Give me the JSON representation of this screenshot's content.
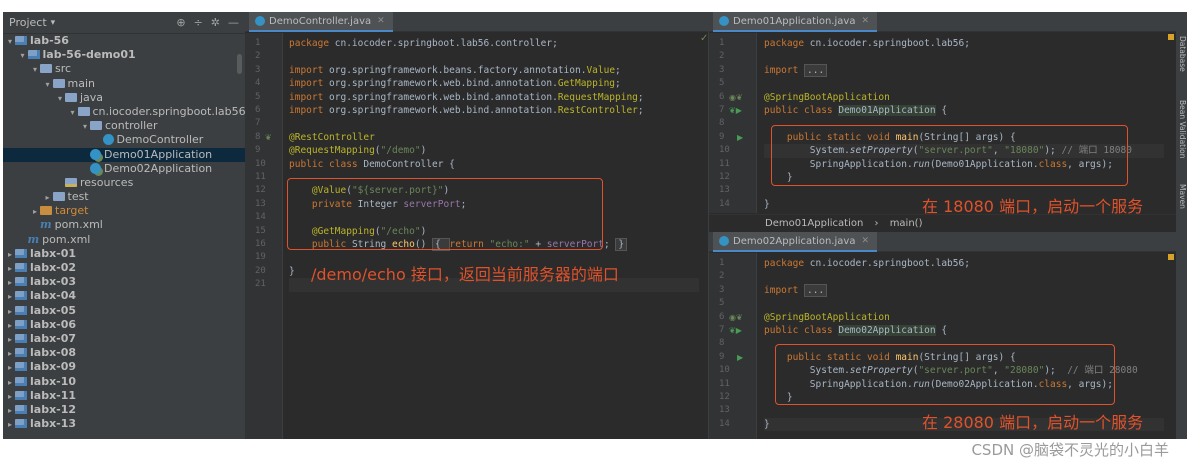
{
  "project_panel": {
    "title": "Project",
    "title_arrow": "▾",
    "header_icons": [
      "⊕",
      "÷",
      "✲",
      "—"
    ],
    "header_icon_names": [
      "locate-icon",
      "collapse-icon",
      "settings-icon",
      "hide-icon"
    ],
    "tree": [
      {
        "label": "lab-56",
        "indent": 0,
        "arrow": "▾",
        "icon": "module",
        "bold": true
      },
      {
        "label": "lab-56-demo01",
        "indent": 1,
        "arrow": "▾",
        "icon": "module",
        "bold": true
      },
      {
        "label": "src",
        "indent": 2,
        "arrow": "▾",
        "icon": "folder"
      },
      {
        "label": "main",
        "indent": 3,
        "arrow": "▾",
        "icon": "folder"
      },
      {
        "label": "java",
        "indent": 4,
        "arrow": "▾",
        "icon": "folder"
      },
      {
        "label": "cn.iocoder.springboot.lab56",
        "indent": 5,
        "arrow": "▾",
        "icon": "package"
      },
      {
        "label": "controller",
        "indent": 6,
        "arrow": "▾",
        "icon": "package"
      },
      {
        "label": "DemoController",
        "indent": 7,
        "arrow": "",
        "icon": "class"
      },
      {
        "label": "Demo01Application",
        "indent": 6,
        "arrow": "",
        "icon": "spring-class",
        "selected": true
      },
      {
        "label": "Demo02Application",
        "indent": 6,
        "arrow": "",
        "icon": "spring-class"
      },
      {
        "label": "resources",
        "indent": 4,
        "arrow": "",
        "icon": "resources"
      },
      {
        "label": "test",
        "indent": 3,
        "arrow": "▸",
        "icon": "folder"
      },
      {
        "label": "target",
        "indent": 2,
        "arrow": "▸",
        "icon": "target",
        "excluded": true
      },
      {
        "label": "pom.xml",
        "indent": 2,
        "arrow": "",
        "icon": "maven"
      },
      {
        "label": "pom.xml",
        "indent": 1,
        "arrow": "",
        "icon": "maven"
      },
      {
        "label": "labx-01",
        "indent": 0,
        "arrow": "▸",
        "icon": "module",
        "bold": true
      },
      {
        "label": "labx-02",
        "indent": 0,
        "arrow": "▸",
        "icon": "module",
        "bold": true
      },
      {
        "label": "labx-03",
        "indent": 0,
        "arrow": "▸",
        "icon": "module",
        "bold": true
      },
      {
        "label": "labx-04",
        "indent": 0,
        "arrow": "▸",
        "icon": "module",
        "bold": true
      },
      {
        "label": "labx-05",
        "indent": 0,
        "arrow": "▸",
        "icon": "module",
        "bold": true
      },
      {
        "label": "labx-06",
        "indent": 0,
        "arrow": "▸",
        "icon": "module",
        "bold": true
      },
      {
        "label": "labx-07",
        "indent": 0,
        "arrow": "▸",
        "icon": "module",
        "bold": true
      },
      {
        "label": "labx-08",
        "indent": 0,
        "arrow": "▸",
        "icon": "module",
        "bold": true
      },
      {
        "label": "labx-09",
        "indent": 0,
        "arrow": "▸",
        "icon": "module",
        "bold": true
      },
      {
        "label": "labx-10",
        "indent": 0,
        "arrow": "▸",
        "icon": "module",
        "bold": true
      },
      {
        "label": "labx-11",
        "indent": 0,
        "arrow": "▸",
        "icon": "module",
        "bold": true
      },
      {
        "label": "labx-12",
        "indent": 0,
        "arrow": "▸",
        "icon": "module",
        "bold": true
      },
      {
        "label": "labx-13",
        "indent": 0,
        "arrow": "▸",
        "icon": "module",
        "bold": true
      }
    ]
  },
  "editor_controller": {
    "tab": {
      "label": "DemoController.java",
      "close": "✕"
    },
    "line_numbers": [
      "1",
      "2",
      "3",
      "4",
      "5",
      "6",
      "7",
      "8",
      "9",
      "10",
      "11",
      "12",
      "13",
      "14",
      "15",
      "16",
      "19",
      "20",
      "21"
    ],
    "lines": [
      [
        {
          "t": "package ",
          "c": "kw"
        },
        {
          "t": "cn.iocoder.springboot.lab56.controller;"
        }
      ],
      [],
      [
        {
          "t": "import ",
          "c": "kw"
        },
        {
          "t": "org.springframework.beans.factory.annotation."
        },
        {
          "t": "Value",
          "c": "ann"
        },
        {
          "t": ";"
        }
      ],
      [
        {
          "t": "import ",
          "c": "kw"
        },
        {
          "t": "org.springframework.web.bind.annotation."
        },
        {
          "t": "GetMapping",
          "c": "ann"
        },
        {
          "t": ";"
        }
      ],
      [
        {
          "t": "import ",
          "c": "kw"
        },
        {
          "t": "org.springframework.web.bind.annotation."
        },
        {
          "t": "RequestMapping",
          "c": "ann"
        },
        {
          "t": ";"
        }
      ],
      [
        {
          "t": "import ",
          "c": "kw"
        },
        {
          "t": "org.springframework.web.bind.annotation."
        },
        {
          "t": "RestController",
          "c": "ann"
        },
        {
          "t": ";"
        }
      ],
      [],
      [
        {
          "t": "@RestController",
          "c": "ann"
        }
      ],
      [
        {
          "t": "@RequestMapping",
          "c": "ann"
        },
        {
          "t": "("
        },
        {
          "t": "\"/demo\"",
          "c": "str"
        },
        {
          "t": ")"
        }
      ],
      [
        {
          "t": "public class ",
          "c": "kw"
        },
        {
          "t": "DemoController {"
        }
      ],
      [],
      [
        {
          "t": "    "
        },
        {
          "t": "@Value",
          "c": "ann"
        },
        {
          "t": "("
        },
        {
          "t": "\"${server.port}\"",
          "c": "str"
        },
        {
          "t": ")"
        }
      ],
      [
        {
          "t": "    "
        },
        {
          "t": "private ",
          "c": "kw"
        },
        {
          "t": "Integer "
        },
        {
          "t": "serverPort",
          "c": "fld"
        },
        {
          "t": ";"
        }
      ],
      [],
      [
        {
          "t": "    "
        },
        {
          "t": "@GetMapping",
          "c": "ann"
        },
        {
          "t": "("
        },
        {
          "t": "\"/echo\"",
          "c": "str"
        },
        {
          "t": ")"
        }
      ],
      [
        {
          "t": "    "
        },
        {
          "t": "public ",
          "c": "kw"
        },
        {
          "t": "String "
        },
        {
          "t": "echo",
          "c": "mth"
        },
        {
          "t": "() "
        },
        {
          "t": "{ ",
          "c": "fold"
        },
        {
          "t": "return ",
          "c": "kw"
        },
        {
          "t": "\"echo:\"",
          "c": "str"
        },
        {
          "t": " + "
        },
        {
          "t": "serverPort",
          "c": "fld"
        },
        {
          "t": "; "
        },
        {
          "t": "}",
          "c": "fold"
        }
      ],
      [],
      [
        {
          "t": "}"
        }
      ],
      []
    ],
    "annotation": "/demo/echo 接口，返回当前服务器的端口",
    "ok_mark": "✓"
  },
  "editor_demo01": {
    "tab": {
      "label": "Demo01Application.java",
      "close": "✕"
    },
    "line_numbers": [
      "1",
      "2",
      "3",
      "5",
      "6",
      "7",
      "8",
      "9",
      "10",
      "11",
      "12",
      "13",
      "14"
    ],
    "lines": [
      [
        {
          "t": "package ",
          "c": "kw"
        },
        {
          "t": "cn.iocoder.springboot.lab56;"
        }
      ],
      [],
      [
        {
          "t": "import ",
          "c": "kw"
        },
        {
          "t": "...",
          "c": "fold"
        }
      ],
      [],
      [
        {
          "t": "@SpringBootApplication",
          "c": "ann"
        }
      ],
      [
        {
          "t": "public class ",
          "c": "kw"
        },
        {
          "t": "Demo01Application",
          "c": "hl"
        },
        {
          "t": " {"
        }
      ],
      [],
      [
        {
          "t": "    "
        },
        {
          "t": "public static void ",
          "c": "kw"
        },
        {
          "t": "main",
          "c": "mth"
        },
        {
          "t": "(String[] args) {"
        }
      ],
      [
        {
          "t": "        System."
        },
        {
          "t": "setProperty",
          "c": "itl"
        },
        {
          "t": "("
        },
        {
          "t": "\"server.port\"",
          "c": "str"
        },
        {
          "t": ", "
        },
        {
          "t": "\"18080\"",
          "c": "str"
        },
        {
          "t": "); "
        },
        {
          "t": "// 端口 18080",
          "c": "cmt"
        }
      ],
      [
        {
          "t": "        SpringApplication."
        },
        {
          "t": "run",
          "c": "itl"
        },
        {
          "t": "(Demo01Application."
        },
        {
          "t": "class",
          "c": "kw"
        },
        {
          "t": ", args);"
        }
      ],
      [
        {
          "t": "    }"
        }
      ],
      [],
      [
        {
          "t": "}"
        }
      ]
    ],
    "annotation": "在 18080 端口，启动一个服务",
    "breadcrumb": [
      "Demo01Application",
      "main()"
    ],
    "breadcrumb_sep": "›"
  },
  "editor_demo02": {
    "tab": {
      "label": "Demo02Application.java",
      "close": "✕"
    },
    "line_numbers": [
      "1",
      "2",
      "3",
      "5",
      "6",
      "7",
      "8",
      "9",
      "10",
      "11",
      "12",
      "13",
      "14"
    ],
    "lines": [
      [
        {
          "t": "package ",
          "c": "kw"
        },
        {
          "t": "cn.iocoder.springboot.lab56;"
        }
      ],
      [],
      [
        {
          "t": "import ",
          "c": "kw"
        },
        {
          "t": "...",
          "c": "fold"
        }
      ],
      [],
      [
        {
          "t": "@SpringBootApplication",
          "c": "ann"
        }
      ],
      [
        {
          "t": "public class ",
          "c": "kw"
        },
        {
          "t": "Demo02Application",
          "c": "hl"
        },
        {
          "t": " {"
        }
      ],
      [],
      [
        {
          "t": "    "
        },
        {
          "t": "public static void ",
          "c": "kw"
        },
        {
          "t": "main",
          "c": "mth"
        },
        {
          "t": "(String[] args) {"
        }
      ],
      [
        {
          "t": "        System."
        },
        {
          "t": "setProperty",
          "c": "itl"
        },
        {
          "t": "("
        },
        {
          "t": "\"server.port\"",
          "c": "str"
        },
        {
          "t": ", "
        },
        {
          "t": "\"28080\"",
          "c": "str"
        },
        {
          "t": ");  "
        },
        {
          "t": "// 端口 28080",
          "c": "cmt"
        }
      ],
      [
        {
          "t": "        SpringApplication."
        },
        {
          "t": "run",
          "c": "itl"
        },
        {
          "t": "(Demo02Application."
        },
        {
          "t": "class",
          "c": "kw"
        },
        {
          "t": ", args);"
        }
      ],
      [
        {
          "t": "    }"
        }
      ],
      [],
      [
        {
          "t": "}"
        }
      ]
    ],
    "annotation": "在 28080 端口，启动一个服务"
  },
  "right_tools": [
    "Database",
    "Bean Validation",
    "Maven"
  ],
  "watermark": "CSDN @脑袋不灵光的小白羊",
  "colors": {
    "background": "#2b2b2b",
    "panel": "#3c3f41",
    "keyword": "#cc7832",
    "annotation": "#bbb529",
    "string": "#6a8759",
    "field": "#9876aa",
    "method": "#ffc66d",
    "callout": "#e0522b"
  }
}
